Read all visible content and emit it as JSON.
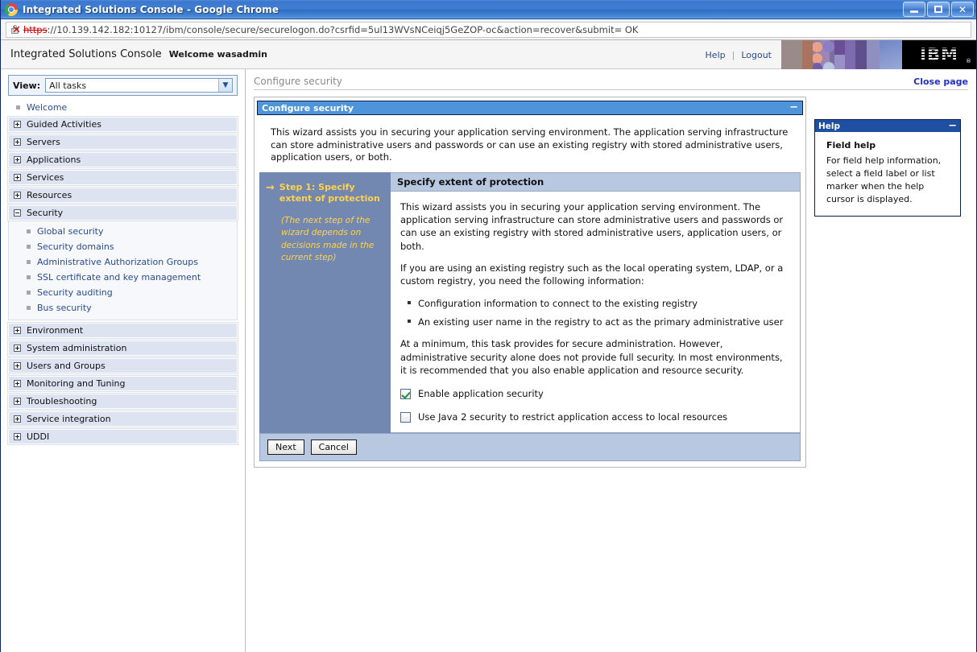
{
  "window": {
    "title": "Integrated Solutions Console - Google Chrome",
    "favicon": "chrome-logo-icon",
    "controls": {
      "minimize": "Minimize",
      "maximize": "Maximize",
      "close": "Close"
    }
  },
  "address_bar": {
    "lock_icon": "insecure-lock-icon",
    "scheme": "https",
    "rest": "://10.139.142.182:10127/ibm/console/secure/securelogon.do?csrfid=5ul13WVsNCeiqj5GeZOP-oc&action=recover&submit= OK",
    "host": "10.139.142.182"
  },
  "header": {
    "product": "Integrated Solutions Console",
    "welcome": "Welcome wasadmin",
    "help_link": "Help",
    "divider": "|",
    "logout_link": "Logout",
    "ibm_logo": "IBM",
    "ibm_reg": "®"
  },
  "sidebar": {
    "view_label": "View:",
    "view_value": "All tasks",
    "welcome_item": "Welcome",
    "groups": [
      {
        "label": "Guided Activities",
        "expanded": false
      },
      {
        "label": "Servers",
        "expanded": false
      },
      {
        "label": "Applications",
        "expanded": false
      },
      {
        "label": "Services",
        "expanded": false
      },
      {
        "label": "Resources",
        "expanded": false
      },
      {
        "label": "Security",
        "expanded": true,
        "children": [
          "Global security",
          "Security domains",
          "Administrative Authorization Groups",
          "SSL certificate and key management",
          "Security auditing",
          "Bus security"
        ]
      },
      {
        "label": "Environment",
        "expanded": false
      },
      {
        "label": "System administration",
        "expanded": false
      },
      {
        "label": "Users and Groups",
        "expanded": false
      },
      {
        "label": "Monitoring and Tuning",
        "expanded": false
      },
      {
        "label": "Troubleshooting",
        "expanded": false
      },
      {
        "label": "Service integration",
        "expanded": false
      },
      {
        "label": "UDDI",
        "expanded": false
      }
    ]
  },
  "main": {
    "breadcrumb": "Configure security",
    "close_page": "Close page",
    "panel_title": "Configure security",
    "panel_collapse": "−",
    "intro": "This wizard assists you in securing your application serving environment. The application serving infrastructure can store administrative users and passwords or can use an existing registry with stored administrative users, application users, or both.",
    "step": {
      "arrow": "→",
      "title": "Step  1: Specify extent of protection",
      "note": "(The next step of the wizard depends on decisions made in the current step)"
    },
    "step_content": {
      "title": "Specify extent of protection",
      "paragraph1": "This wizard assists you in securing your application serving environment. The application serving infrastructure can store administrative users and passwords or can use an existing registry with stored administrative users, application users, or both.",
      "paragraph2": "If you are using an existing registry such as the local operating system, LDAP, or a custom registry, you need the following information:",
      "bullets": [
        "Configuration information to connect to the existing registry",
        "An existing user name in the registry to act as the primary administrative user"
      ],
      "paragraph3": "At a minimum, this task provides for secure administration. However, administrative security alone does not provide full security. In most environments, it is recommended that you also enable application and resource security.",
      "checkboxes": [
        {
          "label": "Enable application security",
          "checked": true
        },
        {
          "label": "Use Java 2 security to restrict application access to local resources",
          "checked": false
        }
      ]
    },
    "buttons": {
      "next": "Next",
      "cancel": "Cancel"
    }
  },
  "help": {
    "panel_title": "Help",
    "panel_collapse": "−",
    "heading": "Field help",
    "text": "For field help information, select a field label or list marker when the help cursor is displayed."
  },
  "colors": {
    "titlebar_blue": "#3f7ed4",
    "panel_blue": "#4e94d8",
    "step_panel": "#7288b0",
    "step_text": "#ffd24d",
    "link_blue": "#2a4b8d",
    "help_blue": "#1f4fa0",
    "button_bar": "#b8c8e0"
  }
}
